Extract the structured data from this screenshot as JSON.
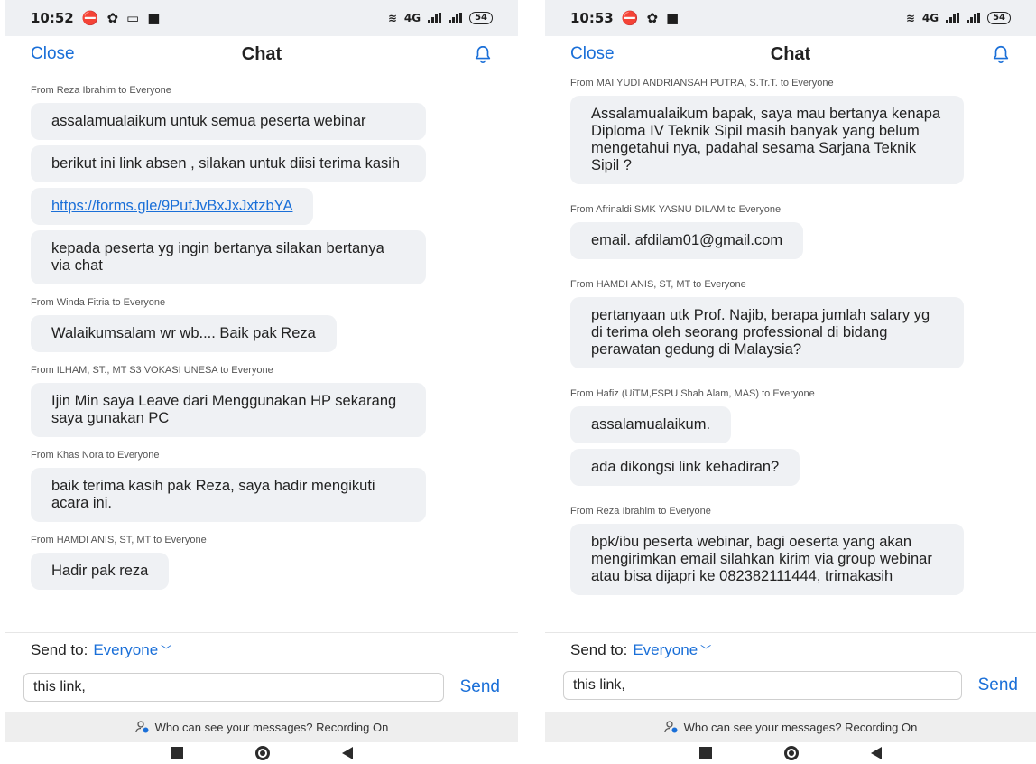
{
  "colors": {
    "accent": "#1a6fd8",
    "bubble": "#eff1f4",
    "status_bar": "#eef0f3"
  },
  "left": {
    "status": {
      "time": "10:52",
      "net": "4G",
      "battery": "54"
    },
    "header": {
      "close": "Close",
      "title": "Chat"
    },
    "groups": [
      {
        "sender": "From Reza Ibrahim to Everyone",
        "messages": [
          "assalamualaikum untuk semua peserta webinar",
          "berikut ini link absen , silakan untuk diisi terima kasih",
          "https://forms.gle/9PufJvBxJxJxtzbYA",
          "kepada peserta yg ingin bertanya silakan bertanya via chat"
        ]
      },
      {
        "sender": "From Winda Fitria to Everyone",
        "messages": [
          "Walaikumsalam wr wb.... Baik pak Reza"
        ]
      },
      {
        "sender": "From ILHAM, ST., MT S3 VOKASI UNESA to Everyone",
        "messages": [
          "Ijin Min saya Leave dari Menggunakan HP sekarang saya gunakan PC"
        ]
      },
      {
        "sender": "From Khas Nora to Everyone",
        "messages": [
          "baik terima kasih pak Reza, saya hadir mengikuti acara ini."
        ]
      },
      {
        "sender": "From HAMDI ANIS, ST, MT to Everyone",
        "messages": [
          "Hadir pak reza"
        ]
      }
    ],
    "send_to": {
      "label": "Send to:",
      "target": "Everyone"
    },
    "input": {
      "value": "this link,"
    },
    "send": "Send",
    "visibility": "Who can see your messages? Recording On"
  },
  "right": {
    "status": {
      "time": "10:53",
      "net": "4G",
      "battery": "54"
    },
    "header": {
      "close": "Close",
      "title": "Chat"
    },
    "groups": [
      {
        "sender": "From MAI YUDI ANDRIANSAH PUTRA, S.Tr.T. to Everyone",
        "messages": [
          "Assalamualaikum bapak, saya mau bertanya kenapa Diploma IV Teknik Sipil masih banyak yang belum mengetahui nya, padahal sesama Sarjana Teknik Sipil ?"
        ]
      },
      {
        "sender": "From Afrinaldi SMK YASNU DILAM to Everyone",
        "messages": [
          "email. afdilam01@gmail.com"
        ]
      },
      {
        "sender": "From HAMDI ANIS, ST, MT to Everyone",
        "messages": [
          "pertanyaan utk Prof. Najib, berapa jumlah salary yg di terima oleh seorang professional di bidang perawatan gedung di Malaysia?"
        ]
      },
      {
        "sender": "From Hafiz (UiTM,FSPU Shah Alam, MAS) to Everyone",
        "messages": [
          "assalamualaikum.",
          "ada dikongsi link kehadiran?"
        ]
      },
      {
        "sender": "From Reza Ibrahim to Everyone",
        "messages": [
          "bpk/ibu peserta webinar, bagi oeserta yang akan mengirimkan email silahkan kirim via group webinar atau bisa dijapri ke 082382111444, trimakasih"
        ]
      }
    ],
    "send_to": {
      "label": "Send to:",
      "target": "Everyone"
    },
    "input": {
      "value": "this link,"
    },
    "send": "Send",
    "visibility": "Who can see your messages? Recording On"
  }
}
